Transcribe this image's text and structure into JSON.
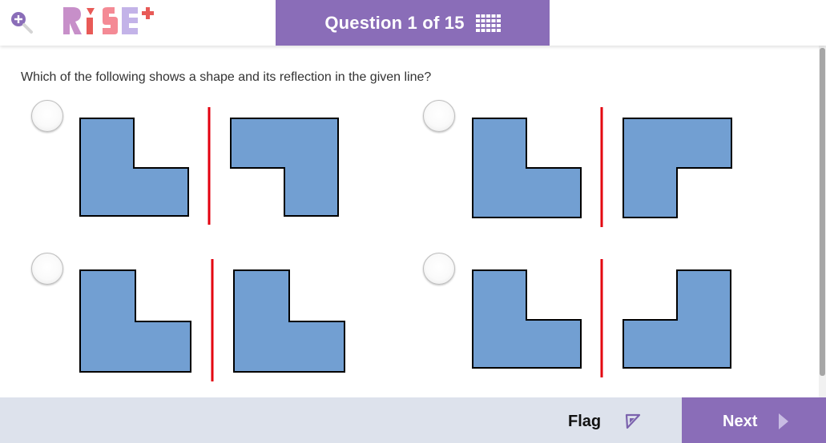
{
  "header": {
    "logo_text": "RiSE+",
    "question_counter": "Question 1 of 15"
  },
  "question": {
    "prompt": "Which of the following shows a shape and its reflection in the given line?",
    "options": [
      {
        "id": "A",
        "description": "L-shape with vertical line; reflection rotated"
      },
      {
        "id": "B",
        "description": "L-shape with vertical line; flipped upside-down L"
      },
      {
        "id": "C",
        "description": "L-shape with vertical line; identical L"
      },
      {
        "id": "D",
        "description": "L-shape with vertical line; mirrored L"
      }
    ]
  },
  "footer": {
    "flag_label": "Flag",
    "next_label": "Next"
  },
  "colors": {
    "accent": "#8a6db8",
    "shape_fill": "#729fd2",
    "mirror_line": "#e3000f",
    "footer_bg": "#dde2ec"
  }
}
